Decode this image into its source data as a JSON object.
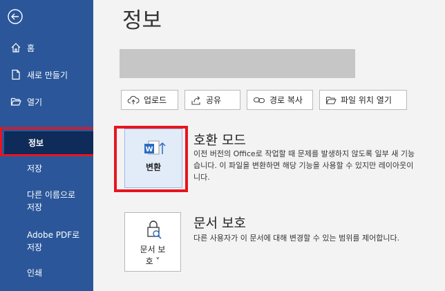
{
  "sidebar": {
    "items": [
      {
        "label": "홈"
      },
      {
        "label": "새로 만들기"
      },
      {
        "label": "열기"
      },
      {
        "label": "정보"
      },
      {
        "label": "저장"
      },
      {
        "label": "다른 이름으로\n저장"
      },
      {
        "label": "Adobe PDF로\n저장"
      },
      {
        "label": "인쇄"
      }
    ]
  },
  "main": {
    "title": "정보",
    "buttons": {
      "upload": "업로드",
      "share": "공유",
      "copy_path": "경로 복사",
      "open_location": "파일 위치 열기"
    },
    "compat": {
      "tile_label": "변환",
      "title": "호환 모드",
      "desc_lines": [
        "이전 버전의 Office로 작업할 때 문제를 발생하지 않도록 일부 새 기능",
        "습니다. 이 파일을 변환하면 해당 기능을 사용할 수 있지만 레이아웃이",
        "니다."
      ]
    },
    "protect": {
      "tile_label_line1": "문서 보",
      "tile_label_line2": "호 ˅",
      "title": "문서 보호",
      "desc": "다른 사용자가 이 문서에 대해 변경할 수 있는 범위를 제어합니다."
    }
  },
  "colors": {
    "sidebar": "#2b579a",
    "sidebar_active": "#0f2b59",
    "highlight": "#e8141f",
    "word_blue": "#2b6bc4"
  }
}
